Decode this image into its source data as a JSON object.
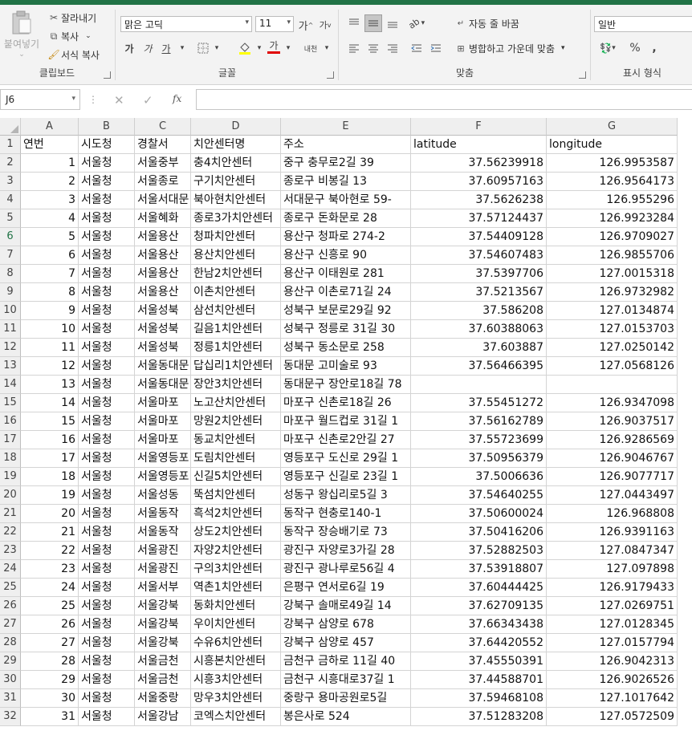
{
  "ribbon": {
    "clipboard": {
      "paste": "붙여넣기",
      "cut": "잘라내기",
      "copy": "복사",
      "format_painter": "서식 복사",
      "label": "클립보드"
    },
    "font": {
      "name": "맑은 고딕",
      "size": "11",
      "grow": "가",
      "shrink": "가",
      "bold": "가",
      "italic": "가",
      "underline": "가",
      "font_color_glyph": "가",
      "phonetic": "내천",
      "label": "글꼴"
    },
    "alignment": {
      "wrap": "자동 줄 바꿈",
      "merge": "병합하고 가운데 맞춤",
      "label": "맞춤"
    },
    "number": {
      "format": "일반",
      "percent": "%",
      "comma": ",",
      "label": "표시 형식"
    }
  },
  "formula_bar": {
    "name_box": "J6",
    "fx": "fx",
    "value": ""
  },
  "columns": [
    "A",
    "B",
    "C",
    "D",
    "E",
    "F",
    "G"
  ],
  "rows": [
    {
      "n": "1",
      "a": "연번",
      "b": "시도청",
      "c": "경찰서",
      "d": "치안센터명",
      "e": "주소",
      "f": "latitude",
      "g": "longitude"
    },
    {
      "n": "2",
      "a": "1",
      "b": "서울청",
      "c": "서울중부",
      "d": "충4치안센터",
      "e": "중구 충무로2길 39",
      "f": "37.56239918",
      "g": "126.9953587"
    },
    {
      "n": "3",
      "a": "2",
      "b": "서울청",
      "c": "서울종로",
      "d": "구기치안센터",
      "e": "종로구 비봉길 13",
      "f": "37.60957163",
      "g": "126.9564173"
    },
    {
      "n": "4",
      "a": "3",
      "b": "서울청",
      "c": "서울서대문",
      "d": "북아현치안센터",
      "e": "서대문구 북아현로 59-",
      "f": "37.5626238",
      "g": "126.955296"
    },
    {
      "n": "5",
      "a": "4",
      "b": "서울청",
      "c": "서울혜화",
      "d": "종로3가치안센터",
      "e": "종로구 돈화문로 28",
      "f": "37.57124437",
      "g": "126.9923284"
    },
    {
      "n": "6",
      "a": "5",
      "b": "서울청",
      "c": "서울용산",
      "d": "청파치안센터",
      "e": "용산구 청파로 274-2",
      "f": "37.54409128",
      "g": "126.9709027"
    },
    {
      "n": "7",
      "a": "6",
      "b": "서울청",
      "c": "서울용산",
      "d": "용산치안센터",
      "e": "용산구 신흥로 90",
      "f": "37.54607483",
      "g": "126.9855706"
    },
    {
      "n": "8",
      "a": "7",
      "b": "서울청",
      "c": "서울용산",
      "d": "한남2치안센터",
      "e": "용산구 이태원로 281",
      "f": "37.5397706",
      "g": "127.0015318"
    },
    {
      "n": "9",
      "a": "8",
      "b": "서울청",
      "c": "서울용산",
      "d": "이촌치안센터",
      "e": "용산구 이촌로71길 24",
      "f": "37.5213567",
      "g": "126.9732982"
    },
    {
      "n": "10",
      "a": "9",
      "b": "서울청",
      "c": "서울성북",
      "d": "삼선치안센터",
      "e": "성북구 보문로29길 92",
      "f": "37.586208",
      "g": "127.0134874"
    },
    {
      "n": "11",
      "a": "10",
      "b": "서울청",
      "c": "서울성북",
      "d": "길음1치안센터",
      "e": "성북구 정릉로 31길 30",
      "f": "37.60388063",
      "g": "127.0153703"
    },
    {
      "n": "12",
      "a": "11",
      "b": "서울청",
      "c": "서울성북",
      "d": "정릉1치안센터",
      "e": "성북구 동소문로 258",
      "f": "37.603887",
      "g": "127.0250142"
    },
    {
      "n": "13",
      "a": "12",
      "b": "서울청",
      "c": "서울동대문",
      "d": "답십리1치안센터",
      "e": "동대문 고미술로 93",
      "f": "37.56466395",
      "g": "127.0568126"
    },
    {
      "n": "14",
      "a": "13",
      "b": "서울청",
      "c": "서울동대문",
      "d": "장안3치안센터",
      "e": "동대문구 장안로18길 78",
      "f": "",
      "g": ""
    },
    {
      "n": "15",
      "a": "14",
      "b": "서울청",
      "c": "서울마포",
      "d": "노고산치안센터",
      "e": "마포구 신촌로18길 26",
      "f": "37.55451272",
      "g": "126.9347098"
    },
    {
      "n": "16",
      "a": "15",
      "b": "서울청",
      "c": "서울마포",
      "d": "망원2치안센터",
      "e": "마포구 월드컵로 31길 1",
      "f": "37.56162789",
      "g": "126.9037517"
    },
    {
      "n": "17",
      "a": "16",
      "b": "서울청",
      "c": "서울마포",
      "d": "동교치안센터",
      "e": "마포구 신촌로2안길 27",
      "f": "37.55723699",
      "g": "126.9286569"
    },
    {
      "n": "18",
      "a": "17",
      "b": "서울청",
      "c": "서울영등포",
      "d": "도림치안센터",
      "e": "영등포구 도신로 29길 1",
      "f": "37.50956379",
      "g": "126.9046767"
    },
    {
      "n": "19",
      "a": "18",
      "b": "서울청",
      "c": "서울영등포",
      "d": "신길5치안센터",
      "e": "영등포구 신길로 23길 1",
      "f": "37.5006636",
      "g": "126.9077717"
    },
    {
      "n": "20",
      "a": "19",
      "b": "서울청",
      "c": "서울성동",
      "d": "뚝섬치안센터",
      "e": "성동구 왕십리로5길 3",
      "f": "37.54640255",
      "g": "127.0443497"
    },
    {
      "n": "21",
      "a": "20",
      "b": "서울청",
      "c": "서울동작",
      "d": "흑석2치안센터",
      "e": "동작구 현충로140-1",
      "f": "37.50600024",
      "g": "126.968808"
    },
    {
      "n": "22",
      "a": "21",
      "b": "서울청",
      "c": "서울동작",
      "d": "상도2치안센터",
      "e": "동작구 장승배기로 73",
      "f": "37.50416206",
      "g": "126.9391163"
    },
    {
      "n": "23",
      "a": "22",
      "b": "서울청",
      "c": "서울광진",
      "d": "자양2치안센터",
      "e": "광진구 자양로3가길 28",
      "f": "37.52882503",
      "g": "127.0847347"
    },
    {
      "n": "24",
      "a": "23",
      "b": "서울청",
      "c": "서울광진",
      "d": "구의3치안센터",
      "e": "광진구 광나루로56길 4",
      "f": "37.53918807",
      "g": "127.097898"
    },
    {
      "n": "25",
      "a": "24",
      "b": "서울청",
      "c": "서울서부",
      "d": "역촌1치안센터",
      "e": "은평구 연서로6길 19",
      "f": "37.60444425",
      "g": "126.9179433"
    },
    {
      "n": "26",
      "a": "25",
      "b": "서울청",
      "c": "서울강북",
      "d": "동화치안센터",
      "e": "강북구 솔매로49길 14",
      "f": "37.62709135",
      "g": "127.0269751"
    },
    {
      "n": "27",
      "a": "26",
      "b": "서울청",
      "c": "서울강북",
      "d": "우이치안센터",
      "e": "강북구 삼양로 678",
      "f": "37.66343438",
      "g": "127.0128345"
    },
    {
      "n": "28",
      "a": "27",
      "b": "서울청",
      "c": "서울강북",
      "d": "수유6치안센터",
      "e": "강북구 삼양로 457",
      "f": "37.64420552",
      "g": "127.0157794"
    },
    {
      "n": "29",
      "a": "28",
      "b": "서울청",
      "c": "서울금천",
      "d": "시흥본치안센터",
      "e": "금천구 금하로 11길 40",
      "f": "37.45550391",
      "g": "126.9042313"
    },
    {
      "n": "30",
      "a": "29",
      "b": "서울청",
      "c": "서울금천",
      "d": "시흥3치안센터",
      "e": "금천구 시흥대로37길 1",
      "f": "37.44588701",
      "g": "126.9026526"
    },
    {
      "n": "31",
      "a": "30",
      "b": "서울청",
      "c": "서울중랑",
      "d": "망우3치안센터",
      "e": "중랑구 용마공원로5길",
      "f": "37.59468108",
      "g": "127.1017642"
    },
    {
      "n": "32",
      "a": "31",
      "b": "서울청",
      "c": "서울강남",
      "d": "코엑스치안센터",
      "e": "봉은사로 524",
      "f": "37.51283208",
      "g": "127.0572509"
    }
  ],
  "colors": {
    "accent": "#217346",
    "header_bg": "#efefef",
    "grid": "#d4d4d4"
  },
  "selected_row": "6"
}
